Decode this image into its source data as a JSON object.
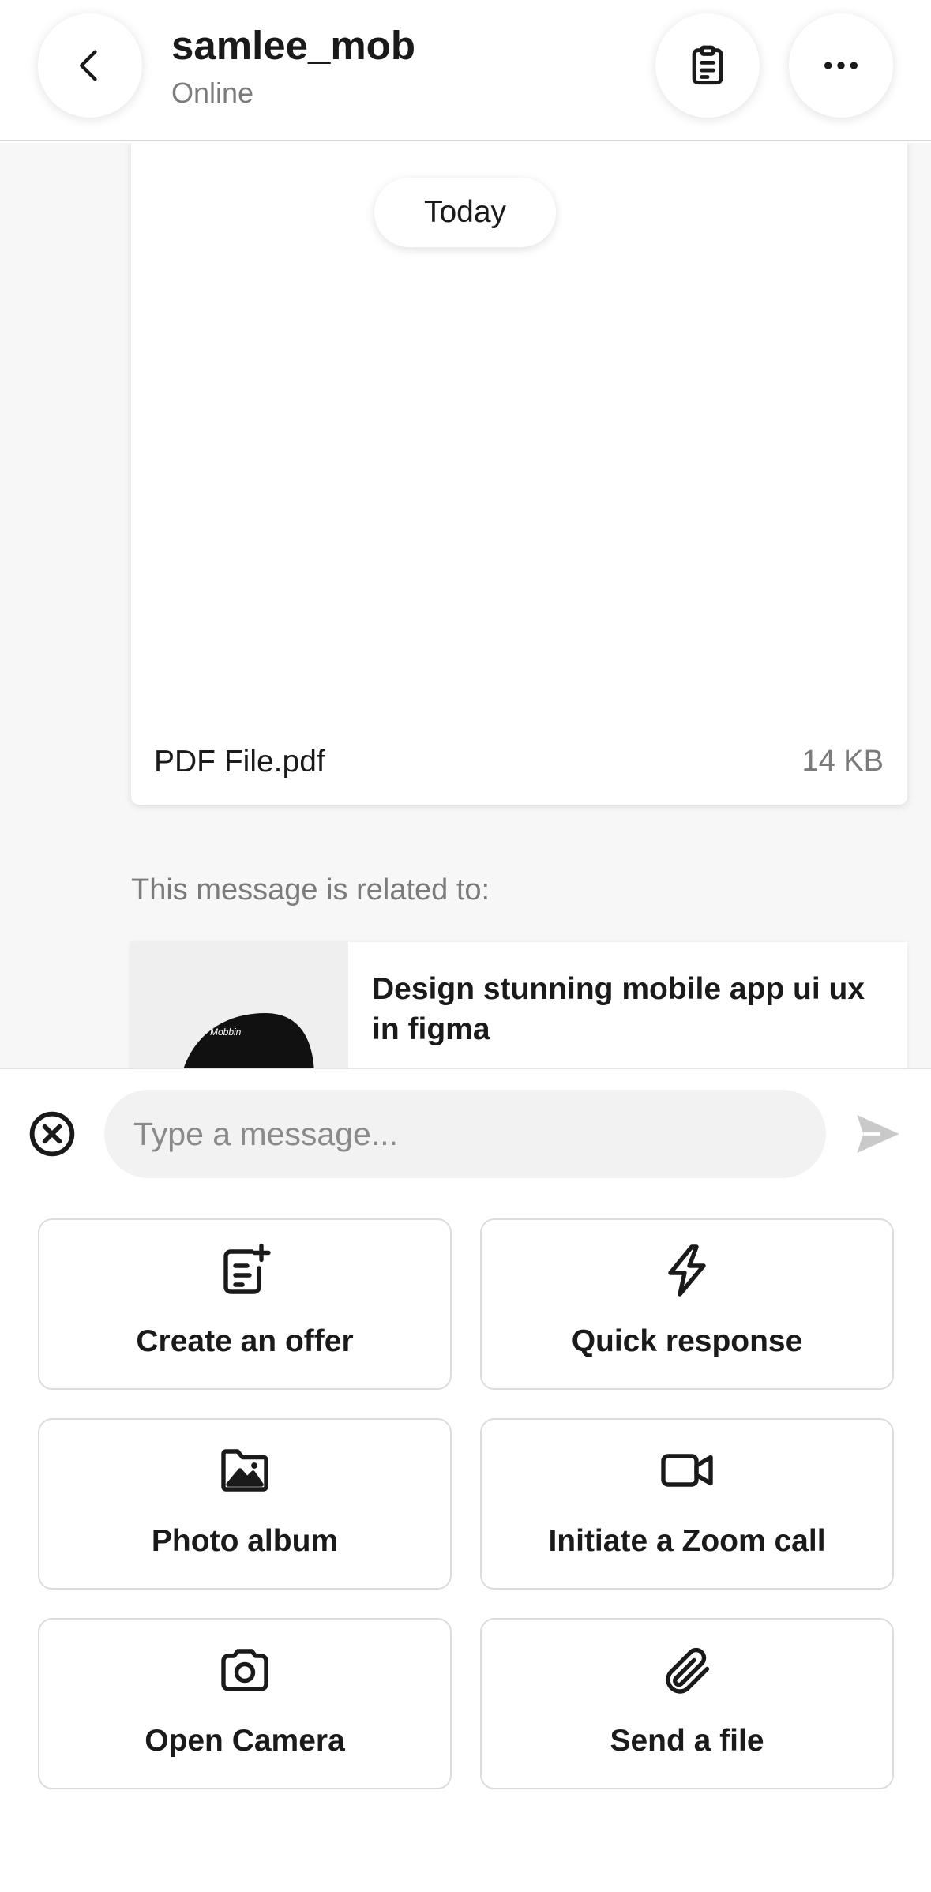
{
  "header": {
    "username": "samlee_mob",
    "status": "Online",
    "back_icon": "chevron-left-icon",
    "clipboard_icon": "clipboard-icon",
    "more_icon": "more-horizontal-icon"
  },
  "chat": {
    "date_separator": "Today",
    "file": {
      "name": "PDF File.pdf",
      "size": "14 KB"
    },
    "related_label": "This message is related to:",
    "related_gig": {
      "title": "Design stunning mobile app ui ux in figma",
      "thumbnail_text": "Mobbin"
    }
  },
  "composer": {
    "placeholder": "Type a message...",
    "close_icon": "close-circle-icon",
    "send_icon": "send-icon"
  },
  "actions": [
    {
      "label": "Create an offer",
      "icon": "offer-add-icon"
    },
    {
      "label": "Quick response",
      "icon": "lightning-icon"
    },
    {
      "label": "Photo album",
      "icon": "photo-folder-icon"
    },
    {
      "label": "Initiate a Zoom call",
      "icon": "video-camera-icon"
    },
    {
      "label": "Open Camera",
      "icon": "camera-icon"
    },
    {
      "label": "Send a file",
      "icon": "paperclip-icon"
    }
  ],
  "colors": {
    "text": "#1a1a1a",
    "muted": "#7b7b7b",
    "chat_bg": "#f7f7f7",
    "input_bg": "#f2f2f2",
    "border": "#dcdcdc"
  }
}
